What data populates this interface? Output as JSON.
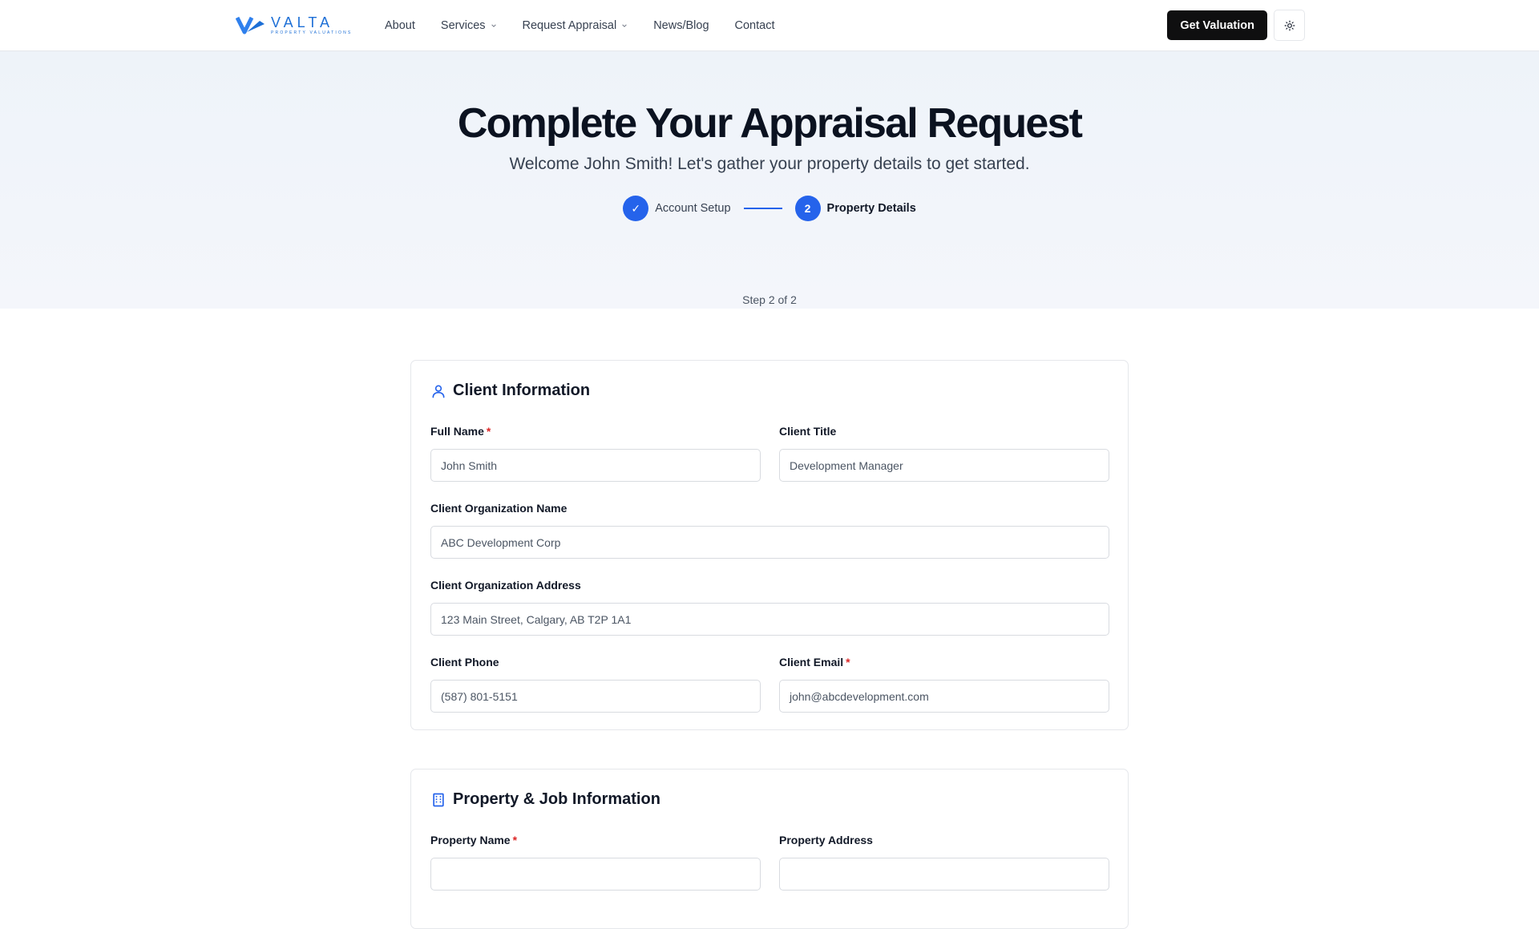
{
  "brand": {
    "name": "VALTA",
    "tagline": "PROPERTY VALUATIONS",
    "accent": "#2563eb"
  },
  "nav": {
    "items": [
      {
        "label": "About",
        "dropdown": false
      },
      {
        "label": "Services",
        "dropdown": true
      },
      {
        "label": "Request Appraisal",
        "dropdown": true
      },
      {
        "label": "News/Blog",
        "dropdown": false
      },
      {
        "label": "Contact",
        "dropdown": false
      }
    ],
    "cta_label": "Get Valuation",
    "theme_toggle_icon": "sun-icon"
  },
  "hero": {
    "title": "Complete Your Appraisal Request",
    "subtitle": "Welcome John Smith! Let's gather your property details to get started.",
    "steps": [
      {
        "marker": "✓",
        "label": "Account Setup",
        "state": "complete"
      },
      {
        "marker": "2",
        "label": "Property Details",
        "state": "active"
      }
    ],
    "step_counter": "Step 2 of 2"
  },
  "client_info": {
    "title": "Client Information",
    "icon": "user-icon",
    "full_name": {
      "label": "Full Name",
      "required": "*",
      "value": "John Smith"
    },
    "client_title": {
      "label": "Client Title",
      "value": "Development Manager"
    },
    "org_name": {
      "label": "Client Organization Name",
      "value": "ABC Development Corp"
    },
    "org_address": {
      "label": "Client Organization Address",
      "value": "123 Main Street, Calgary, AB T2P 1A1"
    },
    "phone": {
      "label": "Client Phone",
      "value": "(587) 801-5151"
    },
    "email": {
      "label": "Client Email",
      "required": "*",
      "value": "john@abcdevelopment.com"
    }
  },
  "property_info": {
    "title": "Property & Job Information",
    "icon": "building-icon",
    "property_name": {
      "label": "Property Name",
      "required": "*"
    },
    "property_address": {
      "label": "Property Address"
    }
  }
}
